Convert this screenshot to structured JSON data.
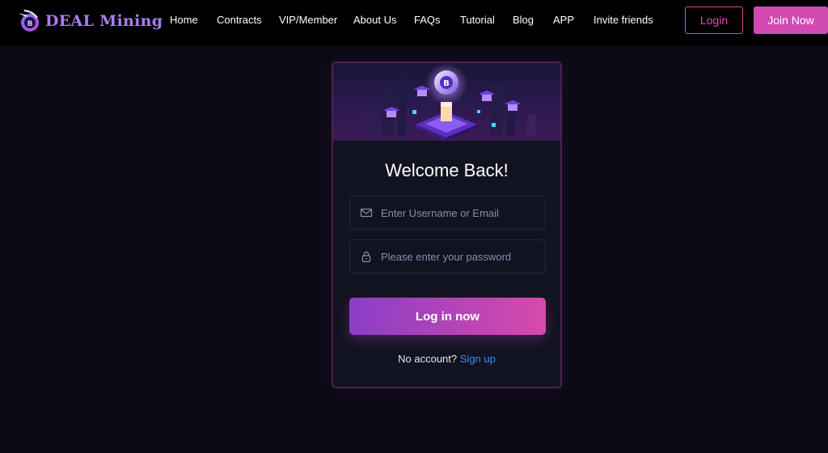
{
  "brand": {
    "name": "DEAL Mining",
    "logo_icon": "pickaxe-coin-icon",
    "accent": "#d14ab2"
  },
  "nav": [
    {
      "label": "Home"
    },
    {
      "label": "Contracts"
    },
    {
      "label": "VIP/Member"
    },
    {
      "label": "About Us"
    },
    {
      "label": "FAQs"
    },
    {
      "label": "Tutorial"
    },
    {
      "label": "Blog"
    },
    {
      "label": "APP"
    },
    {
      "label": "Invite friends"
    }
  ],
  "header_actions": {
    "login_label": "Login",
    "join_label": "Join Now"
  },
  "login_card": {
    "title": "Welcome Back!",
    "hero_icon": "bitcoin-mining-isometric-illustration",
    "username": {
      "placeholder": "Enter Username or Email",
      "value": "",
      "icon": "envelope-icon"
    },
    "password": {
      "placeholder": "Please enter your password",
      "value": "",
      "icon": "lock-icon"
    },
    "submit_label": "Log in now",
    "no_account_text": "No account?",
    "signup_link": "Sign up",
    "link_color": "#3b8cff"
  }
}
